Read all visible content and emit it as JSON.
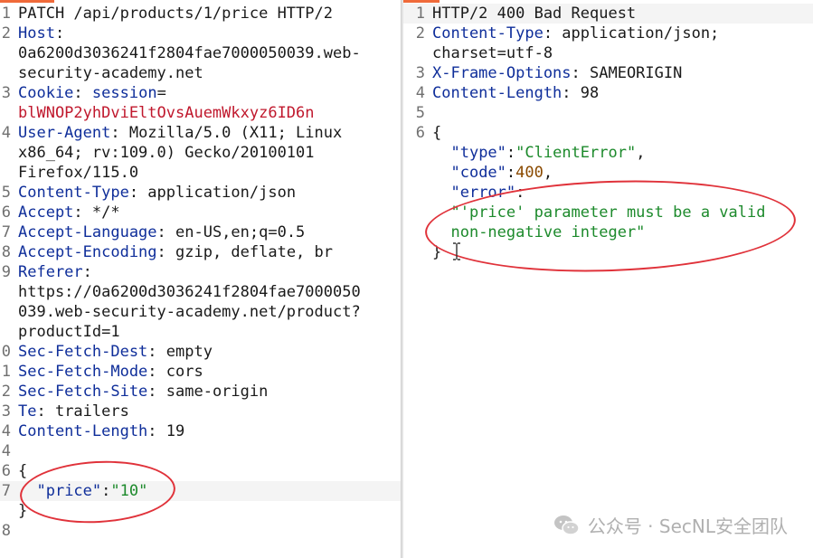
{
  "request": {
    "lines": [
      {
        "n": "1",
        "parts": [
          {
            "t": "PATCH /api/products/1/price HTTP/2",
            "c": "punct"
          }
        ]
      },
      {
        "n": "2",
        "parts": [
          {
            "t": "Host",
            "c": "key"
          },
          {
            "t": ":",
            "c": "punct"
          }
        ]
      },
      {
        "n": "",
        "parts": [
          {
            "t": "0a6200d3036241f2804fae7000050039.web-",
            "c": "punct"
          }
        ]
      },
      {
        "n": "",
        "parts": [
          {
            "t": "security-academy.net",
            "c": "punct"
          }
        ]
      },
      {
        "n": "3",
        "parts": [
          {
            "t": "Cookie",
            "c": "key"
          },
          {
            "t": ": ",
            "c": "punct"
          },
          {
            "t": "session",
            "c": "key"
          },
          {
            "t": "=",
            "c": "punct"
          }
        ]
      },
      {
        "n": "",
        "parts": [
          {
            "t": "blWNOP2yhDviEltOvsAuemWkxyz6ID6n",
            "c": "err"
          }
        ]
      },
      {
        "n": "4",
        "parts": [
          {
            "t": "User-Agent",
            "c": "key"
          },
          {
            "t": ": Mozilla/5.0 (X11; Linux",
            "c": "punct"
          }
        ]
      },
      {
        "n": "",
        "parts": [
          {
            "t": "x86_64; rv:109.0) Gecko/20100101",
            "c": "punct"
          }
        ]
      },
      {
        "n": "",
        "parts": [
          {
            "t": "Firefox/115.0",
            "c": "punct"
          }
        ]
      },
      {
        "n": "5",
        "parts": [
          {
            "t": "Content-Type",
            "c": "key"
          },
          {
            "t": ": application/json",
            "c": "punct"
          }
        ]
      },
      {
        "n": "6",
        "parts": [
          {
            "t": "Accept",
            "c": "key"
          },
          {
            "t": ": */*",
            "c": "punct"
          }
        ]
      },
      {
        "n": "7",
        "parts": [
          {
            "t": "Accept-Language",
            "c": "key"
          },
          {
            "t": ": en-US,en;q=0.5",
            "c": "punct"
          }
        ]
      },
      {
        "n": "8",
        "parts": [
          {
            "t": "Accept-Encoding",
            "c": "key"
          },
          {
            "t": ": gzip, deflate, br",
            "c": "punct"
          }
        ]
      },
      {
        "n": "9",
        "parts": [
          {
            "t": "Referer",
            "c": "key"
          },
          {
            "t": ":",
            "c": "punct"
          }
        ]
      },
      {
        "n": "",
        "parts": [
          {
            "t": "https://0a6200d3036241f2804fae7000050",
            "c": "punct"
          }
        ]
      },
      {
        "n": "",
        "parts": [
          {
            "t": "039.web-security-academy.net/product?",
            "c": "punct"
          }
        ]
      },
      {
        "n": "",
        "parts": [
          {
            "t": "productId=1",
            "c": "punct"
          }
        ]
      },
      {
        "n": "0",
        "parts": [
          {
            "t": "Sec-Fetch-Dest",
            "c": "key"
          },
          {
            "t": ": empty",
            "c": "punct"
          }
        ]
      },
      {
        "n": "1",
        "parts": [
          {
            "t": "Sec-Fetch-Mode",
            "c": "key"
          },
          {
            "t": ": cors",
            "c": "punct"
          }
        ]
      },
      {
        "n": "2",
        "parts": [
          {
            "t": "Sec-Fetch-Site",
            "c": "key"
          },
          {
            "t": ": same-origin",
            "c": "punct"
          }
        ]
      },
      {
        "n": "3",
        "parts": [
          {
            "t": "Te",
            "c": "key"
          },
          {
            "t": ": trailers",
            "c": "punct"
          }
        ]
      },
      {
        "n": "4",
        "parts": [
          {
            "t": "Content-Length",
            "c": "key"
          },
          {
            "t": ": 19",
            "c": "punct"
          }
        ]
      },
      {
        "n": "4",
        "parts": []
      },
      {
        "n": "6",
        "parts": [
          {
            "t": "{",
            "c": "punct"
          }
        ]
      },
      {
        "n": "7",
        "hl": true,
        "parts": [
          {
            "t": "  ",
            "c": "punct"
          },
          {
            "t": "\"price\"",
            "c": "key"
          },
          {
            "t": ":",
            "c": "punct"
          },
          {
            "t": "\"10\"",
            "c": "str"
          }
        ]
      },
      {
        "n": "",
        "parts": [
          {
            "t": "}",
            "c": "punct"
          }
        ]
      },
      {
        "n": "8",
        "parts": []
      }
    ]
  },
  "response": {
    "lines": [
      {
        "n": "1",
        "hl": true,
        "parts": [
          {
            "t": "HTTP/2 400 Bad Request",
            "c": "punct"
          }
        ]
      },
      {
        "n": "2",
        "parts": [
          {
            "t": "Content-Type",
            "c": "key"
          },
          {
            "t": ": application/json;",
            "c": "punct"
          }
        ]
      },
      {
        "n": "",
        "parts": [
          {
            "t": "charset=utf-8",
            "c": "punct"
          }
        ]
      },
      {
        "n": "3",
        "parts": [
          {
            "t": "X-Frame-Options",
            "c": "key"
          },
          {
            "t": ": SAMEORIGIN",
            "c": "punct"
          }
        ]
      },
      {
        "n": "4",
        "parts": [
          {
            "t": "Content-Length",
            "c": "key"
          },
          {
            "t": ": 98",
            "c": "punct"
          }
        ]
      },
      {
        "n": "5",
        "parts": []
      },
      {
        "n": "6",
        "parts": [
          {
            "t": "{",
            "c": "punct"
          }
        ]
      },
      {
        "n": "",
        "parts": [
          {
            "t": "  ",
            "c": "punct"
          },
          {
            "t": "\"type\"",
            "c": "key"
          },
          {
            "t": ":",
            "c": "punct"
          },
          {
            "t": "\"ClientError\"",
            "c": "str"
          },
          {
            "t": ",",
            "c": "punct"
          }
        ]
      },
      {
        "n": "",
        "parts": [
          {
            "t": "  ",
            "c": "punct"
          },
          {
            "t": "\"code\"",
            "c": "key"
          },
          {
            "t": ":",
            "c": "punct"
          },
          {
            "t": "400",
            "c": "num"
          },
          {
            "t": ",",
            "c": "punct"
          }
        ]
      },
      {
        "n": "",
        "parts": [
          {
            "t": "  ",
            "c": "punct"
          },
          {
            "t": "\"error\"",
            "c": "key"
          },
          {
            "t": ":",
            "c": "punct"
          }
        ]
      },
      {
        "n": "",
        "parts": [
          {
            "t": "  ",
            "c": "punct"
          },
          {
            "t": "\"'price' parameter must be a valid",
            "c": "str"
          }
        ]
      },
      {
        "n": "",
        "parts": [
          {
            "t": "  ",
            "c": "punct"
          },
          {
            "t": "non-negative integer\"",
            "c": "str"
          }
        ]
      },
      {
        "n": "",
        "parts": [
          {
            "t": "}",
            "c": "punct"
          }
        ]
      }
    ]
  },
  "watermark": {
    "text": "公众号 · SecNL安全团队",
    "icon": "wechat-icon"
  },
  "colors": {
    "key": "#0f2e9a",
    "error_value": "#c0182d",
    "string": "#1d8a2c",
    "annotation": "#e0323a",
    "tab_accent": "#f06a3a"
  }
}
